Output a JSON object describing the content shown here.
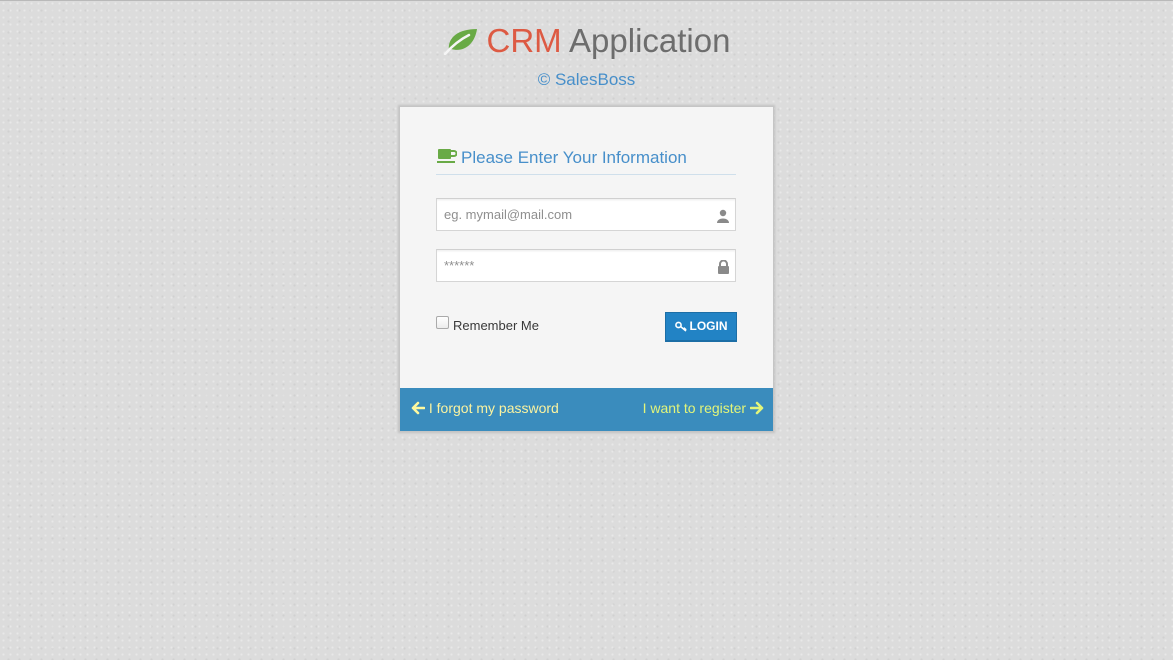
{
  "brand": {
    "crm": "CRM",
    "app": "Application",
    "subtitle": "© SalesBoss"
  },
  "login": {
    "header": "Please Enter Your Information",
    "email_placeholder": "eg. mymail@mail.com",
    "password_placeholder": "******",
    "remember_label": "Remember Me",
    "remember_checked": false,
    "login_label": "LOGIN"
  },
  "toolbar": {
    "forgot_label": "I forgot my password",
    "register_label": "I want to register"
  },
  "colors": {
    "crm": "#dd5a43",
    "accent": "#478fca",
    "button": "#2283c5",
    "toolbar": "#3a8cbd",
    "leaf": "#69aa46",
    "link": "#fef9a0"
  },
  "icons": {
    "brand": "leaf-icon",
    "header": "coffee-icon",
    "email": "user-icon",
    "password": "lock-icon",
    "login": "key-icon",
    "forgot": "arrow-left-icon",
    "register": "arrow-right-icon"
  }
}
